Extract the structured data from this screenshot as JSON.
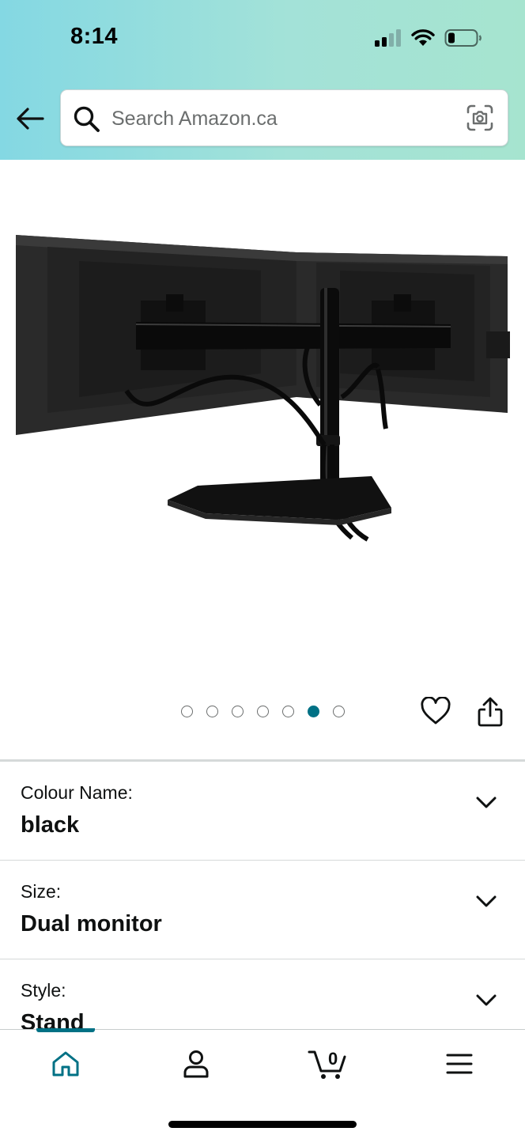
{
  "status_bar": {
    "time": "8:14",
    "icons": [
      "cellular-signal-icon",
      "wifi-icon",
      "battery-icon"
    ]
  },
  "header": {
    "back_icon": "back-arrow-icon",
    "search": {
      "placeholder": "Search Amazon.ca",
      "value": "",
      "left_icon": "search-icon",
      "right_icon": "camera-lens-icon"
    },
    "gradient_colors": [
      "#84d8e3",
      "#a6e4cf"
    ]
  },
  "product": {
    "image": "dual monitor stand product image",
    "carousel": {
      "total": 7,
      "active_index": 5
    },
    "actions": [
      "heart-wishlist-icon",
      "share-icon"
    ]
  },
  "variations": [
    {
      "label": "Colour Name:",
      "value": "black"
    },
    {
      "label": "Size:",
      "value": "Dual monitor"
    },
    {
      "label": "Style:",
      "value": "Stand"
    }
  ],
  "bottom_nav": {
    "items": [
      {
        "name": "home",
        "icon": "home-icon",
        "active": true
      },
      {
        "name": "account",
        "icon": "person-icon",
        "active": false
      },
      {
        "name": "cart",
        "icon": "cart-icon",
        "count": "0",
        "active": false
      },
      {
        "name": "menu",
        "icon": "hamburger-menu-icon",
        "active": false
      }
    ],
    "accent_color": "#007185"
  }
}
